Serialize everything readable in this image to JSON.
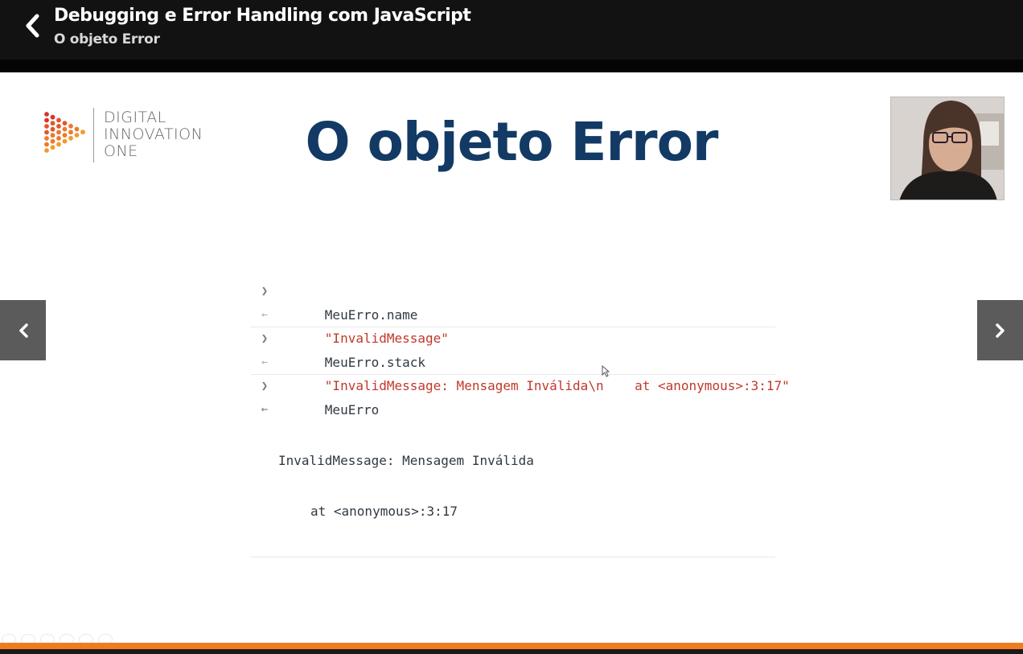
{
  "header": {
    "course_title": "Debugging e Error Handling com JavaScript",
    "lesson_title": "O objeto Error",
    "back_icon": "chevron-left-icon"
  },
  "slide": {
    "logo_lines": [
      "DIGITAL",
      "INNOVATION",
      "ONE"
    ],
    "title": "O objeto Error",
    "title_color": "#123a64",
    "console": [
      {
        "kind": "input",
        "text": "MeuErro.name"
      },
      {
        "kind": "result",
        "text": "\"InvalidMessage\""
      },
      {
        "kind": "input",
        "text": "MeuErro.stack"
      },
      {
        "kind": "result",
        "text": "\"InvalidMessage: Mensagem Inválida\\n    at <anonymous>:3:17\""
      },
      {
        "kind": "input",
        "text": "MeuErro"
      },
      {
        "kind": "output",
        "lines": [
          "InvalidMessage: Mensagem Inválida",
          "at <anonymous>:3:17"
        ]
      }
    ]
  },
  "navigation": {
    "prev_icon": "chevron-left-icon",
    "next_icon": "chevron-right-icon"
  },
  "colors": {
    "accent": "#f07c1f",
    "console_string": "#c0392b"
  }
}
